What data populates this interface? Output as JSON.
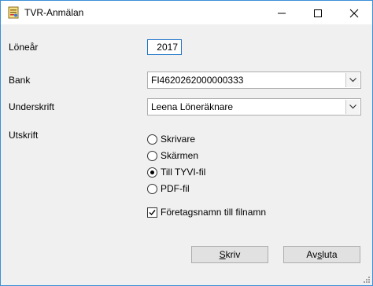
{
  "window": {
    "title": "TVR-Anmälan",
    "icon": "form-app-icon",
    "controls": [
      "minimize-icon",
      "maximize-icon",
      "close-icon"
    ]
  },
  "form": {
    "year_label": "Löneår",
    "year_value": "2017",
    "bank_label": "Bank",
    "bank_value": "FI4620262000000333",
    "signature_label": "Underskrift",
    "signature_value": "Leena Löneräknare",
    "output_label": "Utskrift",
    "output_options": [
      {
        "label": "Skrivare",
        "checked": false
      },
      {
        "label": "Skärmen",
        "checked": false
      },
      {
        "label": "Till TYVI-fil",
        "checked": true
      },
      {
        "label": "PDF-fil",
        "checked": false
      }
    ],
    "company_checkbox_label": "Företagsnamn till filnamn",
    "company_checkbox_checked": true
  },
  "buttons": {
    "print_prefix": "",
    "print_mnemonic": "S",
    "print_rest": "kriv",
    "cancel_prefix": "Av",
    "cancel_mnemonic": "s",
    "cancel_rest": "luta"
  },
  "colors": {
    "window_border": "#3c8fd6",
    "focus_border": "#1e74c8",
    "client_bg": "#f0f0f0",
    "button_bg": "#e1e1e1"
  }
}
